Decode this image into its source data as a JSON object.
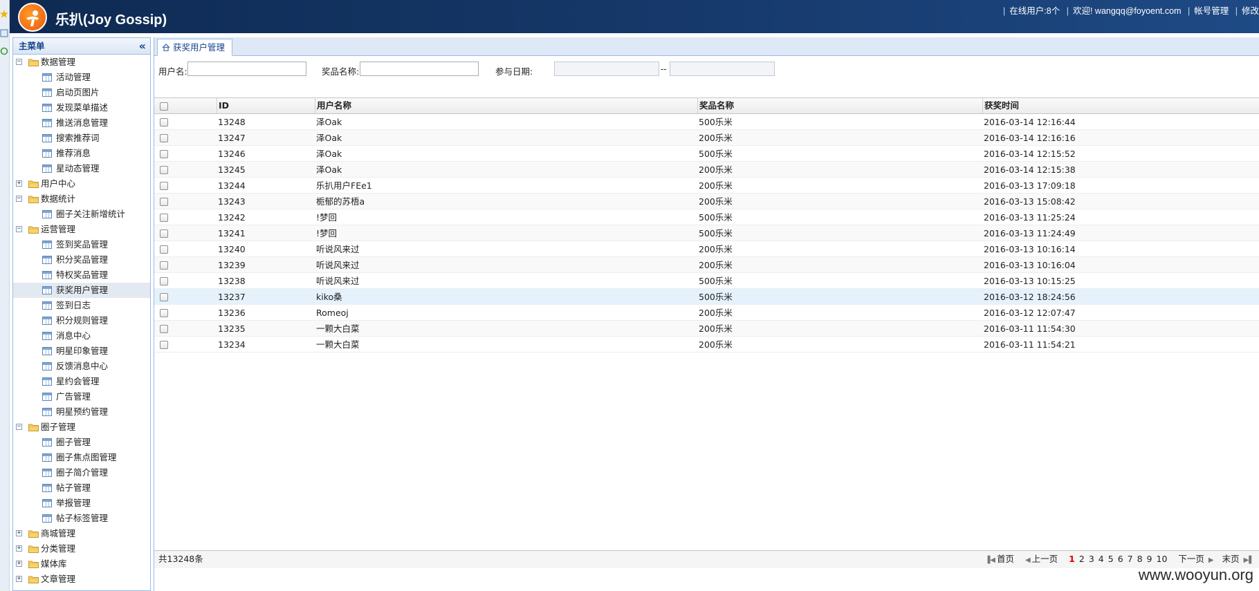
{
  "header": {
    "title": "乐扒(Joy Gossip)",
    "online_users": "在线用户:8个",
    "welcome": "欢迎!",
    "user_email": "wangqq@foyoent.com",
    "account_link": "帐号管理",
    "modify_link": "修改"
  },
  "sidebar": {
    "title": "主菜单",
    "collapse_icon": "«",
    "groups": [
      {
        "label": "数据管理",
        "expanded": true,
        "items": [
          "活动管理",
          "启动页图片",
          "发现菜单描述",
          "推送消息管理",
          "搜索推荐词",
          "推荐消息",
          "星动态管理"
        ]
      },
      {
        "label": "用户中心",
        "expanded": false,
        "items": []
      },
      {
        "label": "数据统计",
        "expanded": true,
        "items": [
          "圈子关注新增统计"
        ]
      },
      {
        "label": "运营管理",
        "expanded": true,
        "items": [
          "签到奖品管理",
          "积分奖品管理",
          "特权奖品管理",
          "获奖用户管理",
          "签到日志",
          "积分规则管理",
          "消息中心",
          "明星印象管理",
          "反馈消息中心",
          "星约会管理",
          "广告管理",
          "明星预约管理"
        ]
      },
      {
        "label": "圈子管理",
        "expanded": true,
        "items": [
          "圈子管理",
          "圈子焦点图管理",
          "圈子简介管理",
          "帖子管理",
          "举报管理",
          "帖子标签管理"
        ]
      },
      {
        "label": "商城管理",
        "expanded": false,
        "items": []
      },
      {
        "label": "分类管理",
        "expanded": false,
        "items": []
      },
      {
        "label": "媒体库",
        "expanded": false,
        "items": []
      },
      {
        "label": "文章管理",
        "expanded": false,
        "items": []
      }
    ],
    "selected_item": "获奖用户管理"
  },
  "tab": {
    "label": "获奖用户管理"
  },
  "filters": {
    "username_label": "用户名:",
    "prize_label": "奖品名称:",
    "date_label": "参与日期:",
    "date_sep": "--",
    "username_value": "",
    "prize_value": "",
    "date_from": "",
    "date_to": ""
  },
  "grid": {
    "columns": [
      "ID",
      "用户名称",
      "奖品名称",
      "获奖时间"
    ],
    "rows": [
      [
        "13248",
        "泽Oak",
        "500乐米",
        "2016-03-14 12:16:44"
      ],
      [
        "13247",
        "泽Oak",
        "200乐米",
        "2016-03-14 12:16:16"
      ],
      [
        "13246",
        "泽Oak",
        "500乐米",
        "2016-03-14 12:15:52"
      ],
      [
        "13245",
        "泽Oak",
        "200乐米",
        "2016-03-14 12:15:38"
      ],
      [
        "13244",
        "乐扒用户FEe1",
        "200乐米",
        "2016-03-13 17:09:18"
      ],
      [
        "13243",
        "栀郁的苏梧a",
        "200乐米",
        "2016-03-13 15:08:42"
      ],
      [
        "13242",
        "!梦回",
        "500乐米",
        "2016-03-13 11:25:24"
      ],
      [
        "13241",
        "!梦回",
        "500乐米",
        "2016-03-13 11:24:49"
      ],
      [
        "13240",
        "听说风来过",
        "200乐米",
        "2016-03-13 10:16:14"
      ],
      [
        "13239",
        "听说风来过",
        "200乐米",
        "2016-03-13 10:16:04"
      ],
      [
        "13238",
        "听说风来过",
        "500乐米",
        "2016-03-13 10:15:25"
      ],
      [
        "13237",
        "kiko桑",
        "500乐米",
        "2016-03-12 18:24:56"
      ],
      [
        "13236",
        "Romeoj",
        "200乐米",
        "2016-03-12 12:07:47"
      ],
      [
        "13235",
        "一颗大白菜",
        "200乐米",
        "2016-03-11 11:54:30"
      ],
      [
        "13234",
        "一颗大白菜",
        "200乐米",
        "2016-03-11 11:54:21"
      ]
    ],
    "highlighted_row_id": "13237"
  },
  "footer": {
    "total": "共13248条",
    "first": "首页",
    "prev": "上一页",
    "pages": [
      "1",
      "2",
      "3",
      "4",
      "5",
      "6",
      "7",
      "8",
      "9",
      "10"
    ],
    "current_page": "1",
    "next": "下一页",
    "last": "末页"
  },
  "watermark": "www.wooyun.org"
}
